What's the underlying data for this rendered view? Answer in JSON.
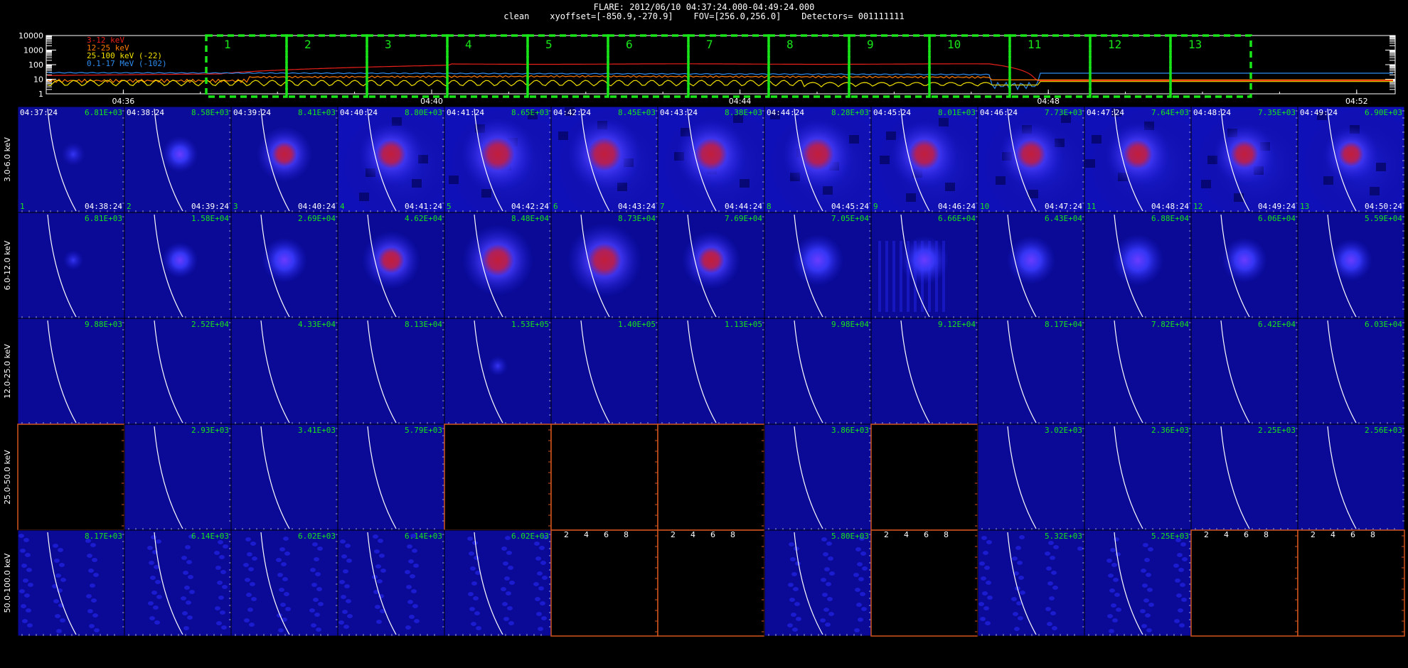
{
  "header": {
    "line1": "FLARE: 2012/06/10 04:37:24.000-04:49:24.000",
    "line2": "clean    xyoffset=[-850.9,-270.9]    FOV=[256.0,256.0]    Detectors= 001111111"
  },
  "lightcurve": {
    "y_ticks": [
      "10000",
      "1000",
      "100",
      "10",
      "1"
    ],
    "x_ticks": [
      "04:36",
      "04:40",
      "04:44",
      "04:48",
      "04:52"
    ],
    "legend": [
      {
        "text": "3-12 keV",
        "color": "#e8201a"
      },
      {
        "text": "12-25 keV",
        "color": "#ff7b00"
      },
      {
        "text": "25-100 keV (-22)",
        "color": "#f0e000"
      },
      {
        "text": "0.1-17 MeV (-102)",
        "color": "#2e8cf0"
      }
    ],
    "intervals": [
      "1",
      "2",
      "3",
      "4",
      "5",
      "6",
      "7",
      "8",
      "9",
      "10",
      "11",
      "12",
      "13"
    ],
    "interval_color": "#19e619"
  },
  "grid": {
    "energy_bands": [
      "3.0-6.0 keV",
      "6.0-12.0 keV",
      "12.0-25.0 keV",
      "25.0-50.0 keV",
      "50.0-100.0 keV"
    ],
    "start_times": [
      "04:37:24",
      "04:38:24",
      "04:39:24",
      "04:40:24",
      "04:41:24",
      "04:42:24",
      "04:43:24",
      "04:44:24",
      "04:45:24",
      "04:46:24",
      "04:47:24",
      "04:48:24",
      "04:49:24"
    ],
    "end_times": [
      "04:38:24",
      "04:39:24",
      "04:40:24",
      "04:41:24",
      "04:42:24",
      "04:43:24",
      "04:44:24",
      "04:45:24",
      "04:46:24",
      "04:47:24",
      "04:48:24",
      "04:49:24",
      "04:50:24"
    ],
    "col_numbers": [
      "1",
      "2",
      "3",
      "4",
      "5",
      "6",
      "7",
      "8",
      "9",
      "10",
      "11",
      "12",
      "13"
    ],
    "values": [
      [
        "6.81E+03",
        "8.58E+03",
        "8.41E+03",
        "8.80E+03",
        "8.65E+03",
        "8.45E+03",
        "8.38E+03",
        "8.28E+03",
        "8.01E+03",
        "7.73E+03",
        "7.64E+03",
        "7.35E+03",
        "6.90E+03"
      ],
      [
        "6.81E+03",
        "1.58E+04",
        "2.69E+04",
        "4.62E+04",
        "8.48E+04",
        "8.73E+04",
        "7.69E+04",
        "7.05E+04",
        "6.66E+04",
        "6.43E+04",
        "6.88E+04",
        "6.06E+04",
        "5.59E+04"
      ],
      [
        "9.88E+03",
        "2.52E+04",
        "4.33E+04",
        "8.13E+04",
        "1.53E+05",
        "1.40E+05",
        "1.13E+05",
        "9.98E+04",
        "9.12E+04",
        "8.17E+04",
        "7.82E+04",
        "6.42E+04",
        "6.03E+04"
      ],
      [
        "",
        "2.93E+03",
        "3.41E+03",
        "5.79E+03",
        "",
        "",
        "",
        "3.86E+03",
        "",
        "3.02E+03",
        "2.36E+03",
        "2.25E+03",
        "2.56E+03"
      ],
      [
        "8.17E+03",
        "6.14E+03",
        "6.02E+03",
        "6.14E+03",
        "6.02E+03",
        "",
        "",
        "5.80E+03",
        "",
        "5.32E+03",
        "5.25E+03",
        "",
        ""
      ]
    ],
    "blank_panels": [
      [
        3,
        0
      ],
      [
        3,
        4
      ],
      [
        3,
        5
      ],
      [
        3,
        6
      ],
      [
        3,
        8
      ],
      [
        4,
        5
      ],
      [
        4,
        6
      ],
      [
        4,
        8
      ],
      [
        4,
        11
      ],
      [
        4,
        12
      ]
    ],
    "panel_tick_labels": [
      "2",
      "4",
      "6",
      "8"
    ],
    "value_color": "#19e619",
    "blank_border_color": "#d2541e"
  }
}
